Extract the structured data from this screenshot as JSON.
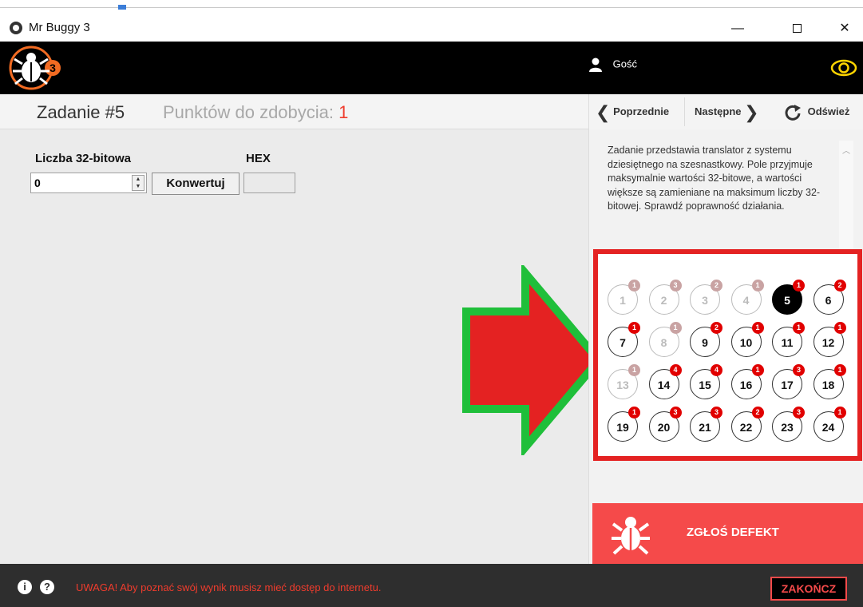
{
  "window": {
    "title": "Mr Buggy 3",
    "minimize_label": "—",
    "close_label": "✕"
  },
  "header": {
    "user_name": "Gość"
  },
  "task": {
    "title": "Zadanie #5",
    "points_label": "Punktów do zdobycia:",
    "points_value": "1"
  },
  "nav": {
    "prev_label": "Poprzednie",
    "next_label": "Następne",
    "refresh_label": "Odśwież"
  },
  "form": {
    "number_label": "Liczba 32-bitowa",
    "number_value": "0",
    "convert_label": "Konwertuj",
    "hex_label": "HEX",
    "hex_value": ""
  },
  "description": "Zadanie przedstawia translator z systemu dziesiętnego na szesnastkowy. Pole przyjmuje maksymalnie wartości 32-bitowe, a wartości większe są zamieniane na maksimum liczby 32-bitowej. Sprawdź poprawność działania.",
  "tasks": [
    {
      "num": "1",
      "badge": "1",
      "state": "dim"
    },
    {
      "num": "2",
      "badge": "3",
      "state": "dim"
    },
    {
      "num": "3",
      "badge": "2",
      "state": "dim"
    },
    {
      "num": "4",
      "badge": "1",
      "state": "dim"
    },
    {
      "num": "5",
      "badge": "1",
      "state": "active"
    },
    {
      "num": "6",
      "badge": "2",
      "state": "normal"
    },
    {
      "num": "7",
      "badge": "1",
      "state": "normal"
    },
    {
      "num": "8",
      "badge": "1",
      "state": "dim"
    },
    {
      "num": "9",
      "badge": "2",
      "state": "normal"
    },
    {
      "num": "10",
      "badge": "1",
      "state": "normal"
    },
    {
      "num": "11",
      "badge": "1",
      "state": "normal"
    },
    {
      "num": "12",
      "badge": "1",
      "state": "normal"
    },
    {
      "num": "13",
      "badge": "1",
      "state": "dim"
    },
    {
      "num": "14",
      "badge": "4",
      "state": "normal"
    },
    {
      "num": "15",
      "badge": "4",
      "state": "normal"
    },
    {
      "num": "16",
      "badge": "1",
      "state": "normal"
    },
    {
      "num": "17",
      "badge": "3",
      "state": "normal"
    },
    {
      "num": "18",
      "badge": "1",
      "state": "normal"
    },
    {
      "num": "19",
      "badge": "1",
      "state": "normal"
    },
    {
      "num": "20",
      "badge": "3",
      "state": "normal"
    },
    {
      "num": "21",
      "badge": "3",
      "state": "normal"
    },
    {
      "num": "22",
      "badge": "2",
      "state": "normal"
    },
    {
      "num": "23",
      "badge": "3",
      "state": "normal"
    },
    {
      "num": "24",
      "badge": "1",
      "state": "normal"
    }
  ],
  "report": {
    "label": "ZGŁOŚ DEFEKT"
  },
  "footer": {
    "warning": "UWAGA! Aby poznać swój wynik musisz mieć dostęp do internetu.",
    "end_label": "ZAKOŃCZ"
  },
  "colors": {
    "accent_red": "#ef3c2d",
    "report_red": "#f54a4a",
    "frame_red": "#e42222",
    "arrow_green": "#1fbf3a"
  }
}
